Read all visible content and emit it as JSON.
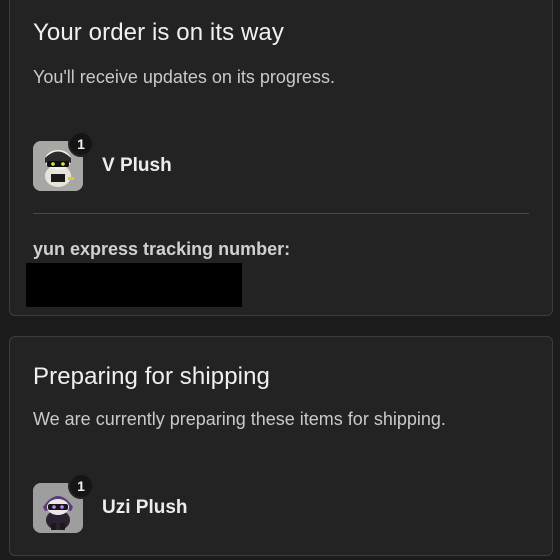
{
  "shipped_card": {
    "title": "Your order is on its way",
    "subtitle": "You'll receive updates on its progress.",
    "item": {
      "name": "V Plush",
      "quantity": "1"
    },
    "tracking_label": "yun express tracking number:"
  },
  "preparing_card": {
    "title": "Preparing for shipping",
    "subtitle": "We are currently preparing these items for shipping.",
    "item": {
      "name": "Uzi Plush",
      "quantity": "1"
    }
  }
}
